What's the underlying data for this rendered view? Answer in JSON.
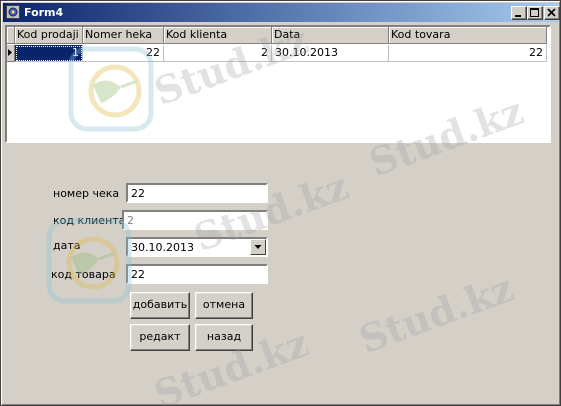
{
  "window": {
    "title": "Form4",
    "watermark_text": "Stud.kz"
  },
  "grid": {
    "columns": [
      "Kod prodaji",
      "Nomer heka",
      "Kod klienta",
      "Data",
      "Kod tovara"
    ],
    "rows": [
      [
        "1",
        "22",
        "2",
        "30.10.2013",
        "22"
      ]
    ]
  },
  "form": {
    "fields": [
      {
        "label": "номер чека",
        "value": "22"
      },
      {
        "label": "код клиента",
        "value": "2"
      },
      {
        "label": "дата",
        "value": "30.10.2013"
      },
      {
        "label": "код товара",
        "value": "22"
      }
    ],
    "buttons": {
      "add": "добавить",
      "cancel": "отмена",
      "edit": "редакт",
      "back": "назад"
    }
  },
  "colors": {
    "titlebar_start": "#0a246a",
    "titlebar_end": "#a6caf0",
    "face": "#d4d0c8",
    "selection": "#0a246a"
  }
}
